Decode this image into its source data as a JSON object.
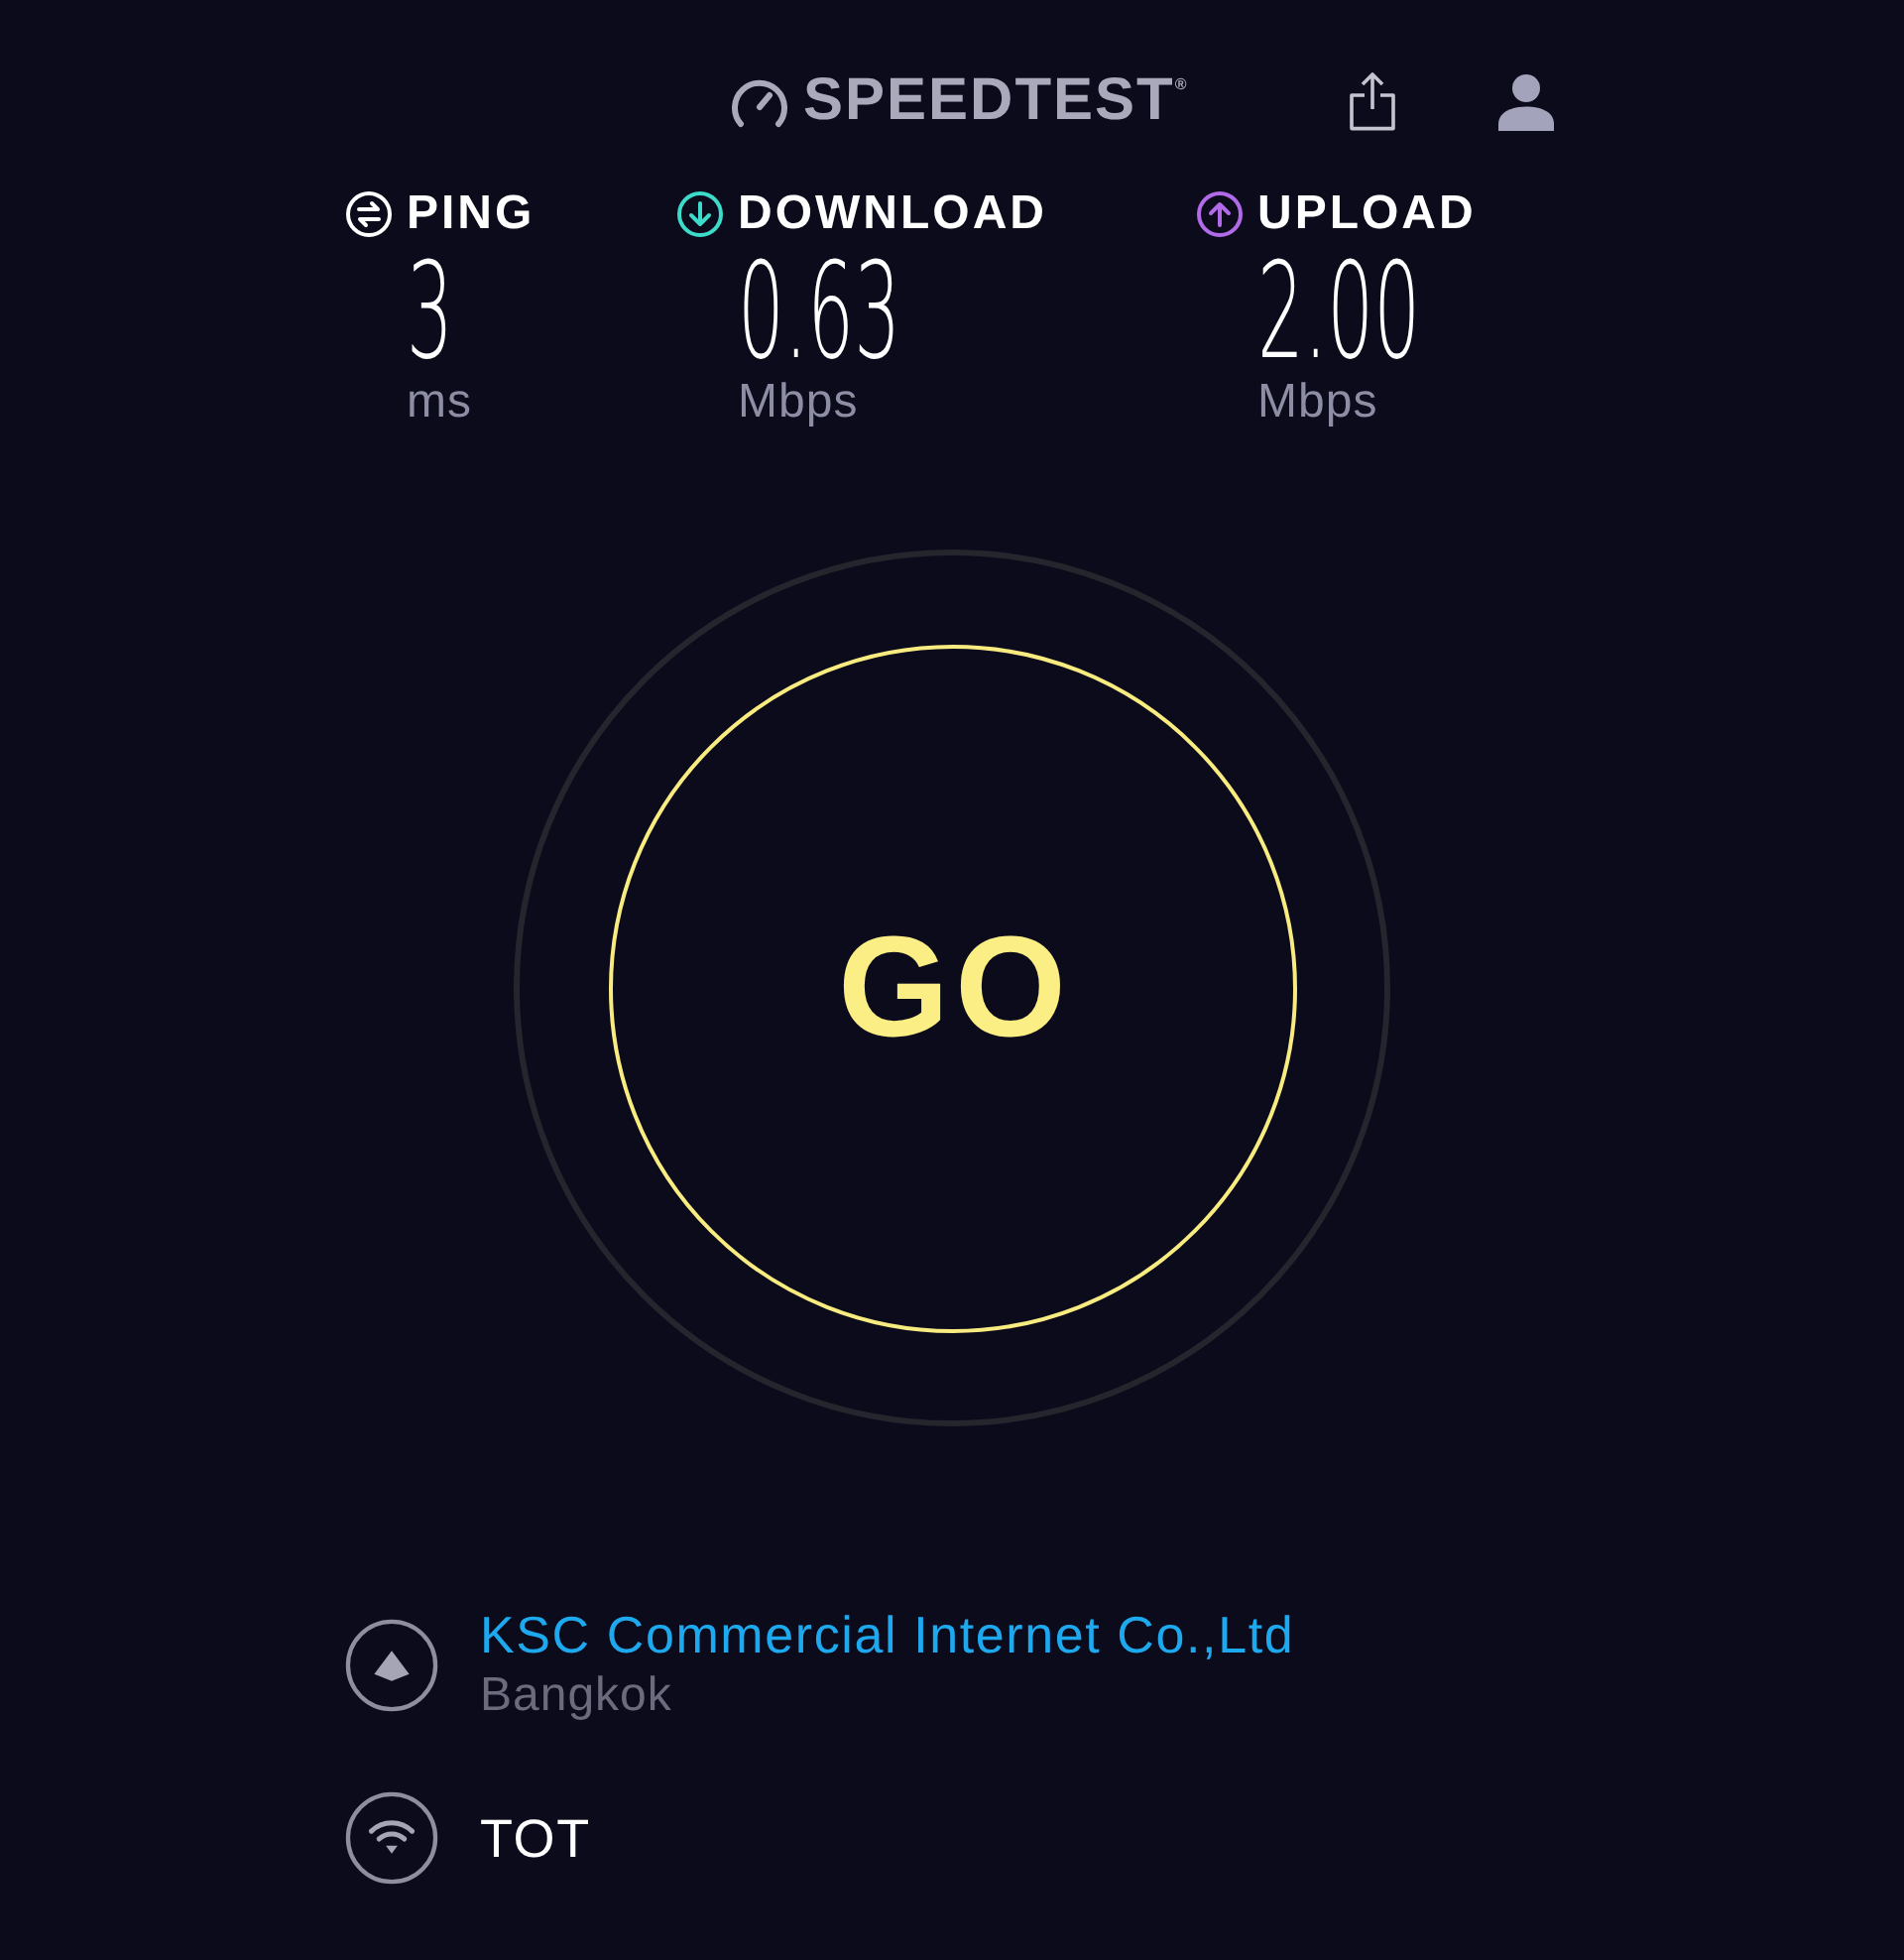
{
  "header": {
    "logo": "SPEEDTEST$^{®}$"
  },
  "metrics": [
    {
      "kind": "ping",
      "label": "PING",
      "value": "3",
      "unit": "ms",
      "color": "#ffffff"
    },
    {
      "kind": "download",
      "label": "DOWNLOAD",
      "value": "0.63",
      "unit": "Mbps",
      "color": "#3ddbc9"
    },
    {
      "kind": "upload",
      "label": "UPLOAD",
      "value": "2.00",
      "unit": "Mbps",
      "color": "#b26be8"
    }
  ],
  "go_button": {
    "label": "GO"
  },
  "connections": [
    {
      "kind": "server",
      "name": "KSC Commercial Internet Co.,Ltd",
      "location": "Bangkok"
    },
    {
      "kind": "network",
      "name": "TOT"
    }
  ]
}
